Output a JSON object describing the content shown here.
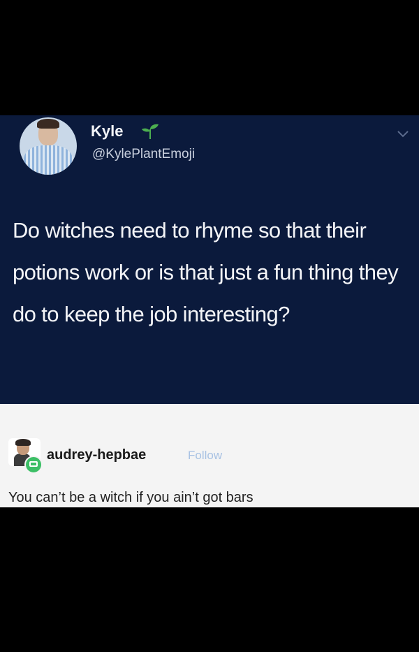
{
  "tweet": {
    "display_name": "Kyle",
    "handle": "@KylePlantEmoji",
    "name_emoji_icon": "seedling-icon",
    "menu_icon": "chevron-down-icon",
    "text": "Do witches need to rhyme so that their potions work or is that just a fun thing they do to keep the job interesting?",
    "colors": {
      "background": "#0b1a3c",
      "text": "#f3f4f7"
    }
  },
  "post": {
    "username": "audrey-hepbae",
    "follow_label": "Follow",
    "text": "You can’t be a witch if you ain’t got bars",
    "colors": {
      "background": "#f4f4f4",
      "follow": "#a8c2e3"
    }
  }
}
